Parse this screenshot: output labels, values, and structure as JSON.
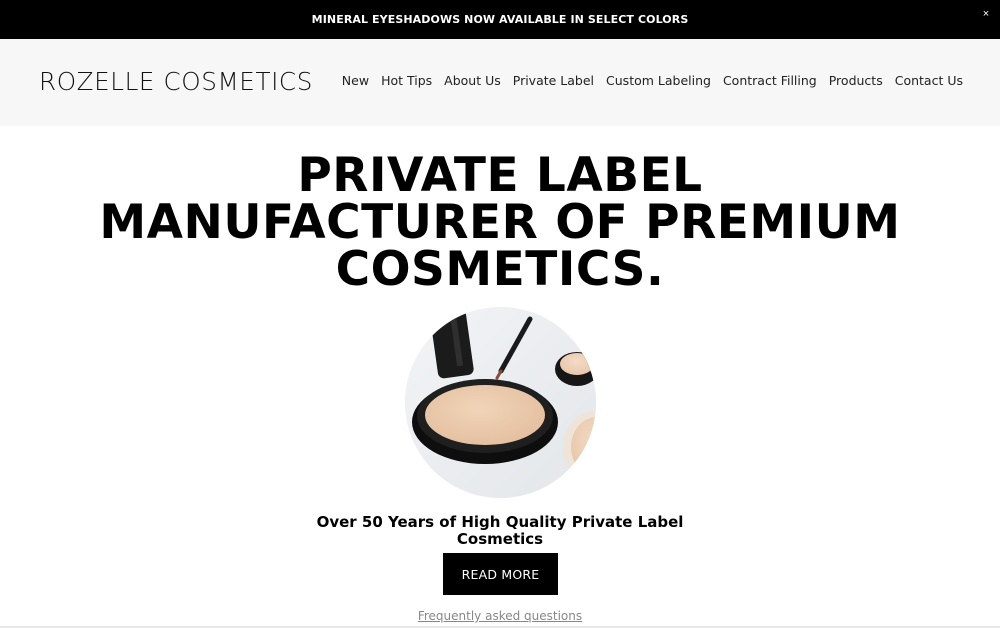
{
  "announcement": {
    "text": "MINERAL EYESHADOWS NOW AVAILABLE IN SELECT COLORS",
    "close_glyph": "×"
  },
  "header": {
    "logo": "ROZELLE COSMETICS",
    "nav": [
      {
        "label": "New"
      },
      {
        "label": "Hot Tips"
      },
      {
        "label": "About Us"
      },
      {
        "label": "Private Label"
      },
      {
        "label": "Custom Labeling"
      },
      {
        "label": "Contract Filling"
      },
      {
        "label": "Products"
      },
      {
        "label": "Contact Us"
      }
    ]
  },
  "hero": {
    "title_lines": [
      "PRIVATE LABEL",
      "MANUFACTURER OF PREMIUM",
      "COSMETICS."
    ],
    "image_icon": "compact-powder-image",
    "subtitle_lines": [
      "Over 50 Years of High Quality Private Label",
      "Cosmetics"
    ],
    "button_label": "READ MORE",
    "faq_link": "Frequently asked questions"
  },
  "colors": {
    "announcement_bg": "#000000",
    "header_bg": "#f7f7f7",
    "button_bg": "#000000",
    "link_gray": "#888888"
  }
}
